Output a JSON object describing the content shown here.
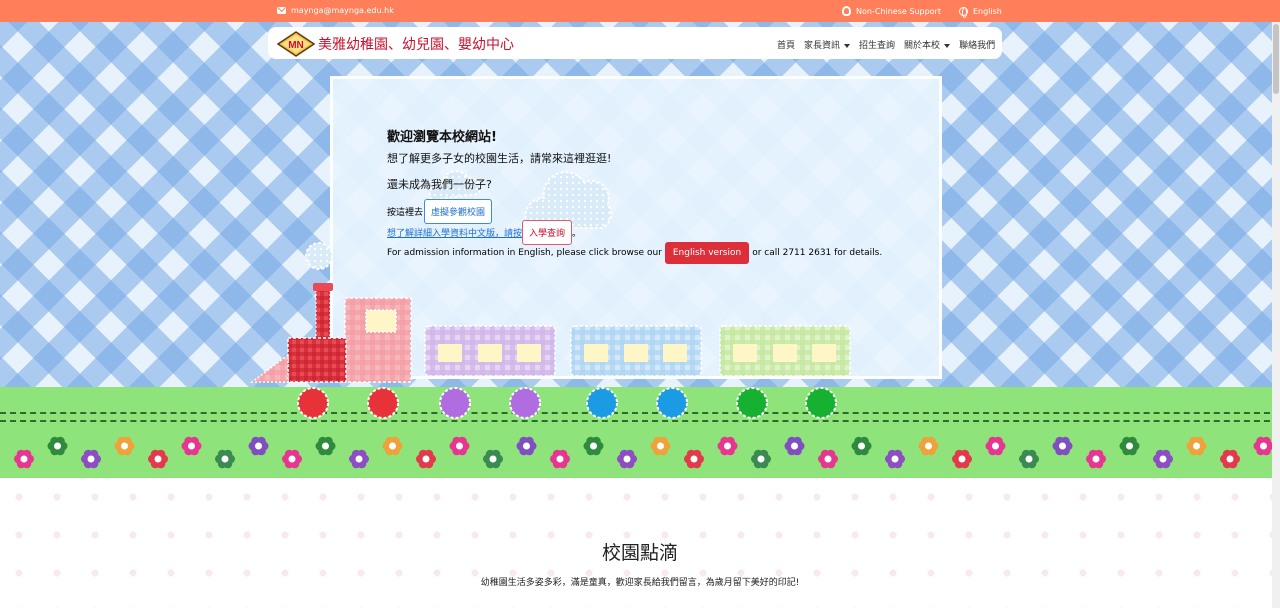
{
  "topbar": {
    "email": "maynga@maynga.edu.hk",
    "non_chinese_support": "Non-Chinese Support",
    "language": "English"
  },
  "brand": {
    "logo_text": "MN",
    "name": "美雅幼稚園、幼兒園、嬰幼中心"
  },
  "nav": {
    "items": [
      {
        "label": "首頁",
        "dropdown": false
      },
      {
        "label": "家長資訊",
        "dropdown": true
      },
      {
        "label": "招生查詢",
        "dropdown": false
      },
      {
        "label": "關於本校",
        "dropdown": true
      },
      {
        "label": "聯絡我們",
        "dropdown": false
      }
    ]
  },
  "hero": {
    "title": "歡迎瀏覽本校網站!",
    "subtitle": "想了解更多子女的校園生活，請常來這裡逛逛!",
    "question": "還未成為我們一份子?",
    "virtual_tour_prefix": "按這裡去",
    "virtual_tour_button": "虛擬參觀校園",
    "admission_link": "想了解詳細入學資料中文版，請按",
    "admission_button": "入學查詢",
    "admission_suffix": "。",
    "english_prefix": "For admission information in English, please click browse our",
    "english_button": "English version",
    "english_suffix": "or call 2711 2631 for details."
  },
  "section": {
    "title": "校園點滴",
    "description": "幼稚園生活多姿多彩，滿是童真，歡迎家長給我們留言，為歲月留下美好的印記!"
  },
  "colors": {
    "topbar": "#ff7f5a",
    "brand_red": "#c8102e",
    "grass": "#8ee47a",
    "button_red": "#dc2f3a",
    "link_blue": "#1e6fd1"
  }
}
